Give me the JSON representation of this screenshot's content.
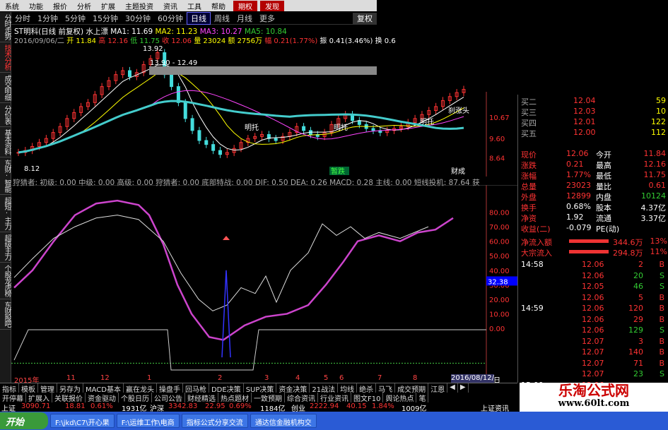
{
  "menu": [
    "系统",
    "功能",
    "报价",
    "分析",
    "扩展",
    "主题投资",
    "资讯",
    "工具",
    "帮助",
    "期权",
    "发现"
  ],
  "periods": [
    "分时",
    "1分钟",
    "5分钟",
    "15分钟",
    "30分钟",
    "60分钟",
    "日线",
    "周线",
    "月线",
    "更多"
  ],
  "period_active": "日线",
  "fq_label": "复权",
  "left_tabs": [
    "分时走势",
    "技术分析",
    "成交明细",
    "分价表",
    "基本资料",
    "东财·智能",
    "超短·主力",
    "超级主力",
    "个股龙虎榜",
    "东财股吧"
  ],
  "stock": {
    "title": "ST明科(日线 前复权) 水上漂",
    "ma1": "MA1: 11.69",
    "ma2": "MA2: 11.23",
    "ma3": "MA3: 10.27",
    "ma5": "MA5: 10.84",
    "line2_date": "2016/09/06/二",
    "line2_open": "开 11.84",
    "line2_high": "高 12.16",
    "line2_low": "低 11.75",
    "line2_close": "收 12.06",
    "line2_vol": "量 23024",
    "line2_amt": "额 2756万",
    "line2_chg": "幅 0.21(1.77%)",
    "line2_amp": "振 0.41(3.46%)",
    "line2_turn": "换 0.6"
  },
  "chart_labels": {
    "peak_price": "13.92",
    "range": "13.90 - 12.49",
    "low_price": "8.12",
    "ylabels": [
      "10.67",
      "9.60",
      "8.64"
    ],
    "tags": [
      "刹涨头",
      "明托",
      "明托",
      "明托",
      "刹涨头",
      "刹涨头"
    ],
    "dieting": "暂跌",
    "chengjiao": "财成"
  },
  "indicator": {
    "header": "狩猎者: 初级: 0.00 中级: 0.00 高级: 0.00 狩猎者: 0.00 底部特战: 0.00 DIF: 0.50 DEA: 0.26 MACD: 0.28 主线: 0.00 短线投机: 87.64 获",
    "ylabels": [
      "80.00",
      "70.00",
      "60.00",
      "50.00",
      "40.00",
      "30.00",
      "20.00",
      "10.00",
      "0.00"
    ],
    "current": "32.38"
  },
  "time_axis": [
    "2015年",
    "11",
    "12",
    "1",
    "2",
    "3",
    "4",
    "5",
    "6",
    "7",
    "8",
    "2016/08/12/五",
    "日线"
  ],
  "quotes": {
    "book": [
      {
        "label": "买二",
        "price": "12.04",
        "vol": "59"
      },
      {
        "label": "买三",
        "price": "12.03",
        "vol": "10"
      },
      {
        "label": "买四",
        "price": "12.01",
        "vol": "122"
      },
      {
        "label": "买五",
        "price": "12.00",
        "vol": "112"
      }
    ],
    "stats": [
      [
        "现价",
        "12.06",
        "今开",
        "11.84"
      ],
      [
        "涨跌",
        "0.21",
        "最高",
        "12.16"
      ],
      [
        "涨幅",
        "1.77%",
        "最低",
        "11.75"
      ],
      [
        "总量",
        "23023",
        "量比",
        "0.61"
      ],
      [
        "外盘",
        "12899",
        "内盘",
        "10124"
      ],
      [
        "换手",
        "0.68%",
        "股本",
        "4.37亿"
      ],
      [
        "净资",
        "1.92",
        "流通",
        "3.37亿"
      ],
      [
        "收益(二)",
        "-0.079",
        "PE(动)",
        ""
      ]
    ],
    "flows": [
      {
        "label": "净流入额",
        "val": "344.6万",
        "pct": "13%"
      },
      {
        "label": "大宗流入",
        "val": "294.8万",
        "pct": "11%"
      }
    ],
    "ticks": [
      {
        "t": "14:58",
        "p": "12.06",
        "v": "2",
        "d": "B"
      },
      {
        "t": "",
        "p": "12.06",
        "v": "20",
        "d": "S"
      },
      {
        "t": "",
        "p": "12.05",
        "v": "46",
        "d": "S"
      },
      {
        "t": "",
        "p": "12.06",
        "v": "5",
        "d": "B"
      },
      {
        "t": "14:59",
        "p": "12.06",
        "v": "120",
        "d": "B"
      },
      {
        "t": "",
        "p": "12.06",
        "v": "29",
        "d": "B"
      },
      {
        "t": "",
        "p": "12.06",
        "v": "129",
        "d": "S"
      },
      {
        "t": "",
        "p": "12.07",
        "v": "3",
        "d": "B"
      },
      {
        "t": "",
        "p": "12.07",
        "v": "140",
        "d": "B"
      },
      {
        "t": "",
        "p": "12.07",
        "v": "71",
        "d": "B"
      },
      {
        "t": "",
        "p": "12.07",
        "v": "23",
        "d": "S"
      },
      {
        "t": "15:00",
        "p": "12.06",
        "v": "",
        "d": ""
      }
    ]
  },
  "bottom_tabs1": [
    "指标",
    "模板",
    "管理",
    "另存为",
    "MACD基本",
    "赢在龙头",
    "操盘手",
    "回马枪",
    "DDE决策",
    "SUP决策",
    "资金决策",
    "21战法",
    "均线",
    "绝杀",
    "马飞",
    "成交预期",
    "江恩",
    "◀",
    "▶"
  ],
  "bottom_tabs2": [
    "开停幕",
    "扩展入",
    "关联报价",
    "资金驱动",
    "个股日历",
    "公司公告",
    "财经精选",
    "热点题材",
    "一致预期",
    "综合资讯",
    "行业资讯",
    "图文F10",
    "舆论热点",
    "笔"
  ],
  "ticker": {
    "a_label": "上证",
    "a_val": "3090.71",
    "a_chg": "18.81",
    "a_pct": "0.61%",
    "a_amt": "1931亿",
    "b_label": "沪深",
    "b_val": "3342.83",
    "b_chg": "22.95",
    "b_pct": "0.69%",
    "b_amt": "1184亿",
    "c_label": "创业",
    "c_val": "2222.94",
    "c_chg": "40.15",
    "c_pct": "1.84%",
    "c_amt": "1009亿",
    "d_label": "上证资讯"
  },
  "taskbar": {
    "start": "开始",
    "items": [
      "F:\\jkd\\C7\\开心果",
      "F:\\运维工作\\电商",
      "指标公式分享交流",
      "通达信金融机构交"
    ]
  },
  "watermark": {
    "line1": "乐淘公式网",
    "line2": "www.60lt.com"
  }
}
